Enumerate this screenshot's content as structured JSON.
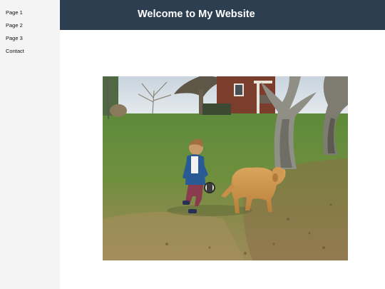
{
  "nav": {
    "items": [
      {
        "label": "Page 1"
      },
      {
        "label": "Page 2"
      },
      {
        "label": "Page 3"
      },
      {
        "label": "Contact"
      }
    ]
  },
  "header": {
    "title": "Welcome to My Website"
  },
  "colors": {
    "header_bg": "#2c3e50",
    "sidebar_bg": "#f4f4f4",
    "page_bg": "#ffffff"
  }
}
